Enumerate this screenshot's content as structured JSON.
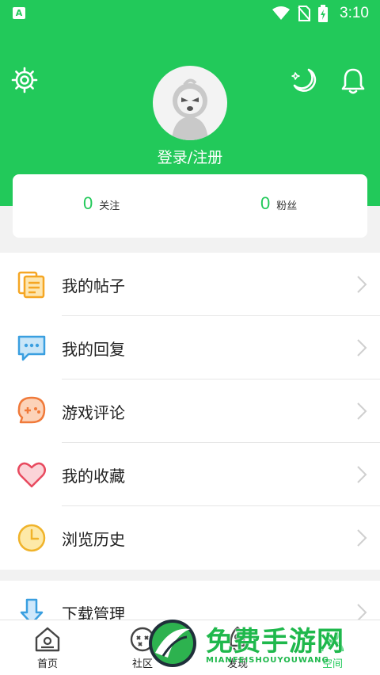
{
  "status_bar": {
    "time": "3:10",
    "app_badge": "A"
  },
  "header": {
    "login_text": "登录/注册",
    "icons": {
      "settings": "gear-icon",
      "night_mode": "moon-icon",
      "notifications": "bell-icon"
    }
  },
  "follow_card": {
    "following": {
      "count": "0",
      "label": "关注"
    },
    "followers": {
      "count": "0",
      "label": "粉丝"
    }
  },
  "menu": {
    "items": [
      {
        "label": "我的帖子",
        "icon": "posts-icon"
      },
      {
        "label": "我的回复",
        "icon": "reply-icon"
      },
      {
        "label": "游戏评论",
        "icon": "game-comment-icon"
      },
      {
        "label": "我的收藏",
        "icon": "heart-icon"
      },
      {
        "label": "浏览历史",
        "icon": "clock-icon"
      }
    ]
  },
  "menu2": {
    "items": [
      {
        "label": "下载管理",
        "icon": "download-icon"
      }
    ]
  },
  "bottom_nav": {
    "items": [
      {
        "label": "首页",
        "icon": "home-icon"
      },
      {
        "label": "社区",
        "icon": "community-icon"
      },
      {
        "label": "发现",
        "icon": "discover-icon"
      },
      {
        "label": "空间",
        "icon": "space-icon"
      }
    ]
  },
  "watermark": {
    "title": "免费手游网",
    "subtitle": "MIANFEISHOUYOUWANG"
  },
  "colors": {
    "primary": "#22c95a",
    "card_bg": "#ffffff",
    "page_bg": "#f2f2f2"
  }
}
